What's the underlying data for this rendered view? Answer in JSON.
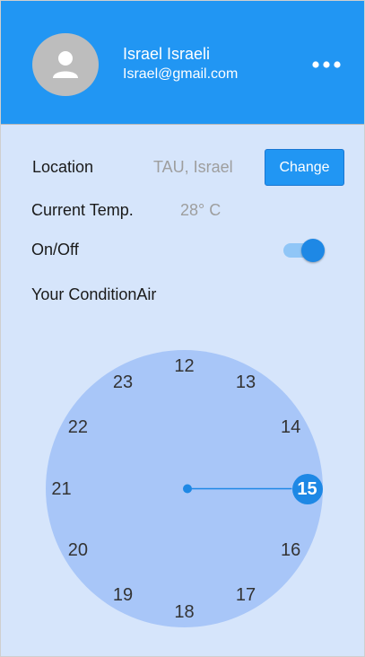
{
  "colors": {
    "header_bg": "#2196f3",
    "page_bg": "#d6e5fb",
    "dial_bg": "#a8c6f8",
    "accent": "#1e88e5"
  },
  "profile": {
    "name": "Israel Israeli",
    "email": "Israel@gmail.com",
    "avatar_icon": "person-icon",
    "menu_icon": "more-horiz-icon"
  },
  "location": {
    "label": "Location",
    "value": "TAU, Israel",
    "button_label": "Change"
  },
  "temperature": {
    "label": "Current Temp.",
    "value": "28° C"
  },
  "power": {
    "label": "On/Off",
    "on": true
  },
  "condition": {
    "label": "Your ConditionAir"
  },
  "dial": {
    "hours": [
      "12",
      "13",
      "14",
      "15",
      "16",
      "17",
      "18",
      "19",
      "20",
      "21",
      "22",
      "23"
    ],
    "selected": "15"
  }
}
